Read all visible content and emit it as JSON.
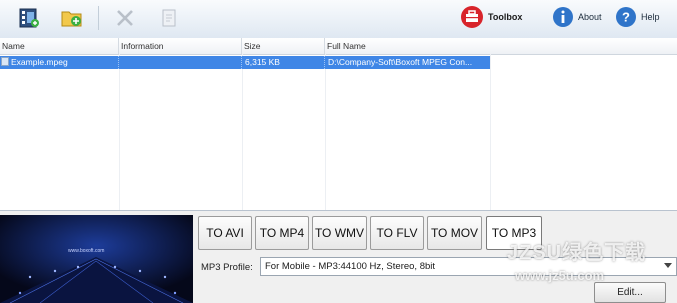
{
  "toolbar": {
    "buttons": [
      {
        "name": "add-video-icon"
      },
      {
        "name": "add-folder-icon"
      },
      {
        "name": "remove-icon"
      },
      {
        "name": "clear-icon"
      }
    ],
    "toolbox_label": "Toolbox",
    "about_label": "About",
    "help_label": "Help"
  },
  "file_list": {
    "columns": [
      "Name",
      "Information",
      "Size",
      "Full Name"
    ],
    "rows": [
      {
        "name": "Example.mpeg",
        "information": "",
        "size": "6,315 KB",
        "full_name": "D:\\Company-Soft\\Boxoft MPEG Con..."
      }
    ]
  },
  "convert": {
    "formats": [
      "TO AVI",
      "TO MP4",
      "TO WMV",
      "TO FLV",
      "TO MOV",
      "TO MP3"
    ],
    "active_format": "TO MP3",
    "profile_label": "MP3 Profile:",
    "profile_value": "For Mobile - MP3:44100 Hz, Stereo, 8bit",
    "edit_label": "Edit..."
  },
  "preview": {
    "caption": "www.boxoft.com"
  },
  "watermark": {
    "line1": "JZSU绿色下载",
    "line2": "www.jz5u.com"
  },
  "colors": {
    "selection": "#3f86e6",
    "toolbox_red": "#d8242b",
    "help_blue": "#2f74c9"
  }
}
